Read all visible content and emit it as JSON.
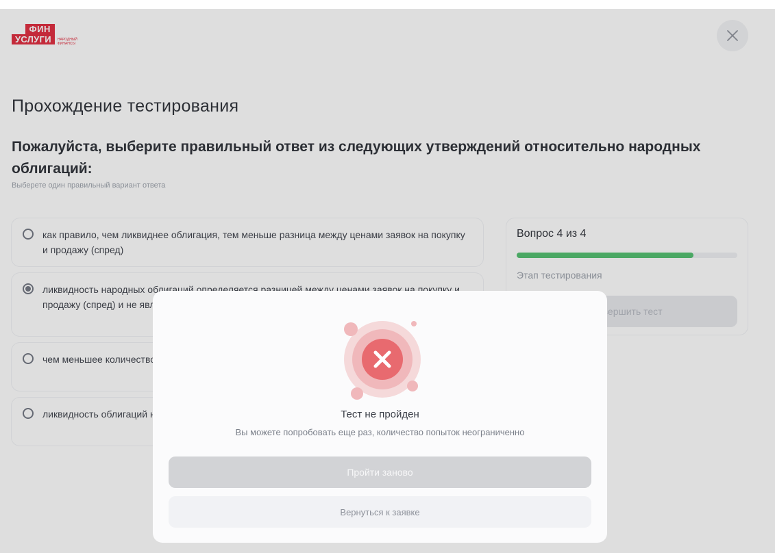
{
  "header": {
    "logo_top": "ФИН",
    "logo_bottom": "УСЛУГИ",
    "logo_sub": "НАРОДНЫЙ ФИНАНСЫ",
    "close_icon": "close-icon"
  },
  "main": {
    "page_title": "Прохождение тестирования",
    "question": "Пожалуйста, выберите правильный ответ из следующих утверждений относительно народных облигаций:",
    "hint": "Выберете один правильный вариант ответа",
    "options": [
      {
        "label": "как правило, чем ликвиднее облигация, тем меньше разница между ценами заявок на покупку и продажу (спред)",
        "selected": false
      },
      {
        "label": "ликвидность народных облигаций определяется разницей между ценами заявок на покупку и продажу (спред) и не является характеристикой финансовым инструментом",
        "selected": true
      },
      {
        "label": "чем меньшее количество облигаций доступно для покупки, тем выше ликвидность облигаций",
        "selected": false
      },
      {
        "label": "ликвидность облигаций не зависит от спроса и предложения (спроса на облигации)",
        "selected": false
      }
    ]
  },
  "side": {
    "question_counter": "Вопрос 4 из 4",
    "progress": 0.8,
    "stage_label": "Этап тестирования",
    "finish_label": "Завершить тест"
  },
  "modal": {
    "title": "Тест не пройден",
    "text": "Вы можете попробовать еще раз, количество попыток неограниченно",
    "retry_label": "Пройти заново",
    "back_label": "Вернуться к заявке",
    "icon": "failed-x-icon"
  },
  "colors": {
    "brand": "#e0273a",
    "progress": "#4fbf6d",
    "error": "#e86a6f"
  }
}
